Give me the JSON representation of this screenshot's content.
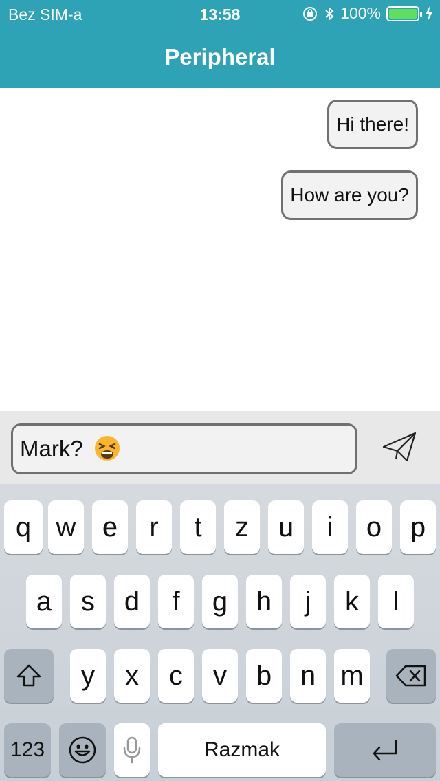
{
  "status_bar": {
    "carrier": "Bez SIM-a",
    "time": "13:58",
    "battery_percent": "100%",
    "battery_level": 1.0,
    "icons": [
      "orientation-lock-icon",
      "bluetooth-icon",
      "battery-icon",
      "charging-icon"
    ]
  },
  "nav": {
    "title": "Peripheral"
  },
  "messages": [
    {
      "text": "Hi there!"
    },
    {
      "text": "How are you?"
    }
  ],
  "composer": {
    "text": "Mark?",
    "emoji": "tired-face-emoji",
    "send_icon": "paper-plane-icon"
  },
  "keyboard": {
    "row1": [
      "q",
      "w",
      "e",
      "r",
      "t",
      "z",
      "u",
      "i",
      "o",
      "p"
    ],
    "row2": [
      "a",
      "s",
      "d",
      "f",
      "g",
      "h",
      "j",
      "k",
      "l"
    ],
    "row3": [
      "y",
      "x",
      "c",
      "v",
      "b",
      "n",
      "m"
    ],
    "numbers_label": "123",
    "space_label": "Razmak",
    "shift_icon": "shift-icon",
    "backspace_icon": "backspace-icon",
    "emoji_icon": "emoji-keyboard-icon",
    "mic_icon": "microphone-icon",
    "return_icon": "return-icon"
  },
  "colors": {
    "header": "#2fa3b6",
    "bubble_border": "#707070",
    "bubble_fill": "#f2f2f2",
    "battery": "#5ee05e"
  }
}
